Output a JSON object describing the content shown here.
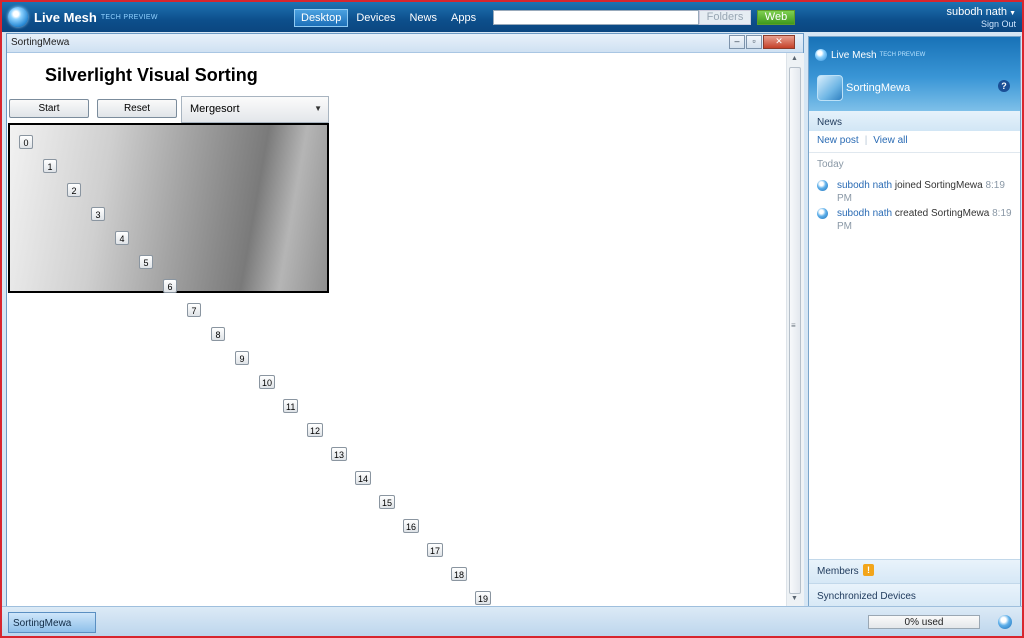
{
  "header": {
    "brand": "Live Mesh",
    "brand_sub": "TECH PREVIEW",
    "nav": [
      {
        "label": "Desktop",
        "active": true
      },
      {
        "label": "Devices",
        "active": false
      },
      {
        "label": "News",
        "active": false
      },
      {
        "label": "Apps",
        "active": false
      }
    ],
    "search_value": "",
    "folders_label": "Folders",
    "web_label": "Web",
    "user_name": "subodh nath",
    "sign_out": "Sign Out"
  },
  "window": {
    "title": "SortingMewa",
    "controls": [
      "minimize",
      "restore",
      "close"
    ]
  },
  "app": {
    "title": "Silverlight Visual Sorting",
    "start_label": "Start",
    "reset_label": "Reset",
    "algorithm": "Mergesort",
    "numbers": [
      "0",
      "1",
      "2",
      "3",
      "4",
      "5",
      "6",
      "7",
      "8",
      "9",
      "10",
      "11",
      "12",
      "13",
      "14",
      "15",
      "16",
      "17",
      "18",
      "19"
    ]
  },
  "panel": {
    "brand": "Live Mesh",
    "brand_sub": "TECH PREVIEW",
    "folder_name": "SortingMewa",
    "help": "?",
    "news_title": "News",
    "new_post": "New post",
    "view_all": "View all",
    "today": "Today",
    "items": [
      {
        "user": "subodh nath",
        "action": "joined SortingMewa",
        "time": "8:19 PM"
      },
      {
        "user": "subodh nath",
        "action": "created SortingMewa",
        "time": "8:19 PM"
      }
    ],
    "members": "Members",
    "sync_devices": "Synchronized Devices"
  },
  "bottom": {
    "task": "SortingMewa",
    "usage": "0% used"
  },
  "colors": {
    "header_bg": "#0d4f8c",
    "web_button": "#3f9a1c",
    "link": "#2a6bb4",
    "frame_border": "#d8262e"
  }
}
